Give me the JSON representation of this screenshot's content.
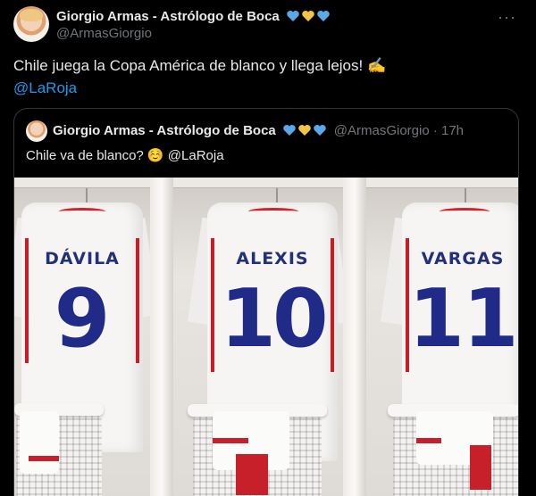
{
  "author": {
    "name": "Giorgio Armas - Astrólogo de Boca",
    "handle": "@ArmasGiorgio",
    "badges": [
      "blue-heart",
      "yellow-heart",
      "blue-heart"
    ]
  },
  "tweet": {
    "text": "Chile juega la Copa América de blanco y llega lejos! ✍️",
    "mention": "@LaRoja",
    "more_label": "···"
  },
  "quoted": {
    "name": "Giorgio Armas - Astrólogo de Boca",
    "handle": "@ArmasGiorgio · 17h",
    "text": "Chile va de blanco? ☺️",
    "mention": "@LaRoja"
  },
  "photo": {
    "jerseys": [
      {
        "player": "DÁVILA",
        "number": "9"
      },
      {
        "player": "ALEXIS",
        "number": "10"
      },
      {
        "player": "VARGAS",
        "number": "11"
      }
    ]
  },
  "colors": {
    "background": "#000000",
    "text": "#e7e9ea",
    "muted": "#71767b",
    "link": "#1d9bf0",
    "heart_blue": "#5aa9e6",
    "heart_yellow": "#f4c542",
    "jersey_number": "#1f2b86",
    "trim_red": "#c91d25"
  }
}
